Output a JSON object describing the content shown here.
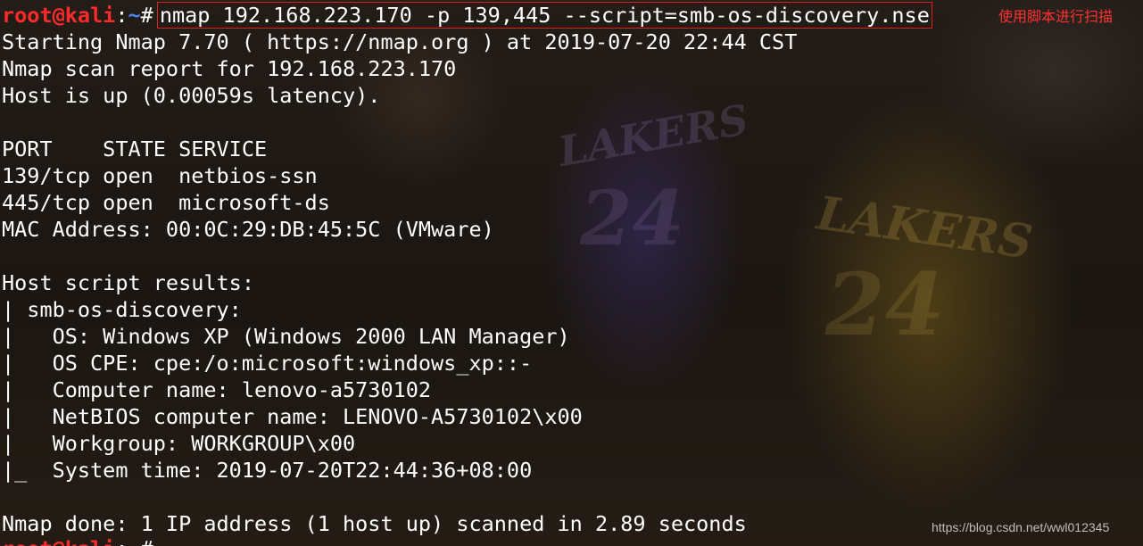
{
  "prompt": {
    "user": "root@kali",
    "colon": ":",
    "path": "~",
    "hash": "#"
  },
  "command": "nmap 192.168.223.170 -p 139,445 --script=smb-os-discovery.nse",
  "annotation": "使用脚本进行扫描",
  "output": [
    "Starting Nmap 7.70 ( https://nmap.org ) at 2019-07-20 22:44 CST",
    "Nmap scan report for 192.168.223.170",
    "Host is up (0.00059s latency).",
    "",
    "PORT    STATE SERVICE",
    "139/tcp open  netbios-ssn",
    "445/tcp open  microsoft-ds",
    "MAC Address: 00:0C:29:DB:45:5C (VMware)",
    "",
    "Host script results:",
    "| smb-os-discovery:",
    "|   OS: Windows XP (Windows 2000 LAN Manager)",
    "|   OS CPE: cpe:/o:microsoft:windows_xp::-",
    "|   Computer name: lenovo-a5730102",
    "|   NetBIOS computer name: LENOVO-A5730102\\x00",
    "|   Workgroup: WORKGROUP\\x00",
    "|_  System time: 2019-07-20T22:44:36+08:00",
    "",
    "Nmap done: 1 IP address (1 host up) scanned in 2.89 seconds"
  ],
  "watermark": "https://blog.csdn.net/wwl012345",
  "background": {
    "text_1": "LAKERS",
    "number_1": "24",
    "text_2": "LAKERS",
    "number_2": "24"
  },
  "colors": {
    "prompt_user": "#ff2a2a",
    "prompt_path": "#4a86ff",
    "annotation": "#ff3030",
    "highlight_box": "#e02020",
    "text": "#ffffff"
  }
}
